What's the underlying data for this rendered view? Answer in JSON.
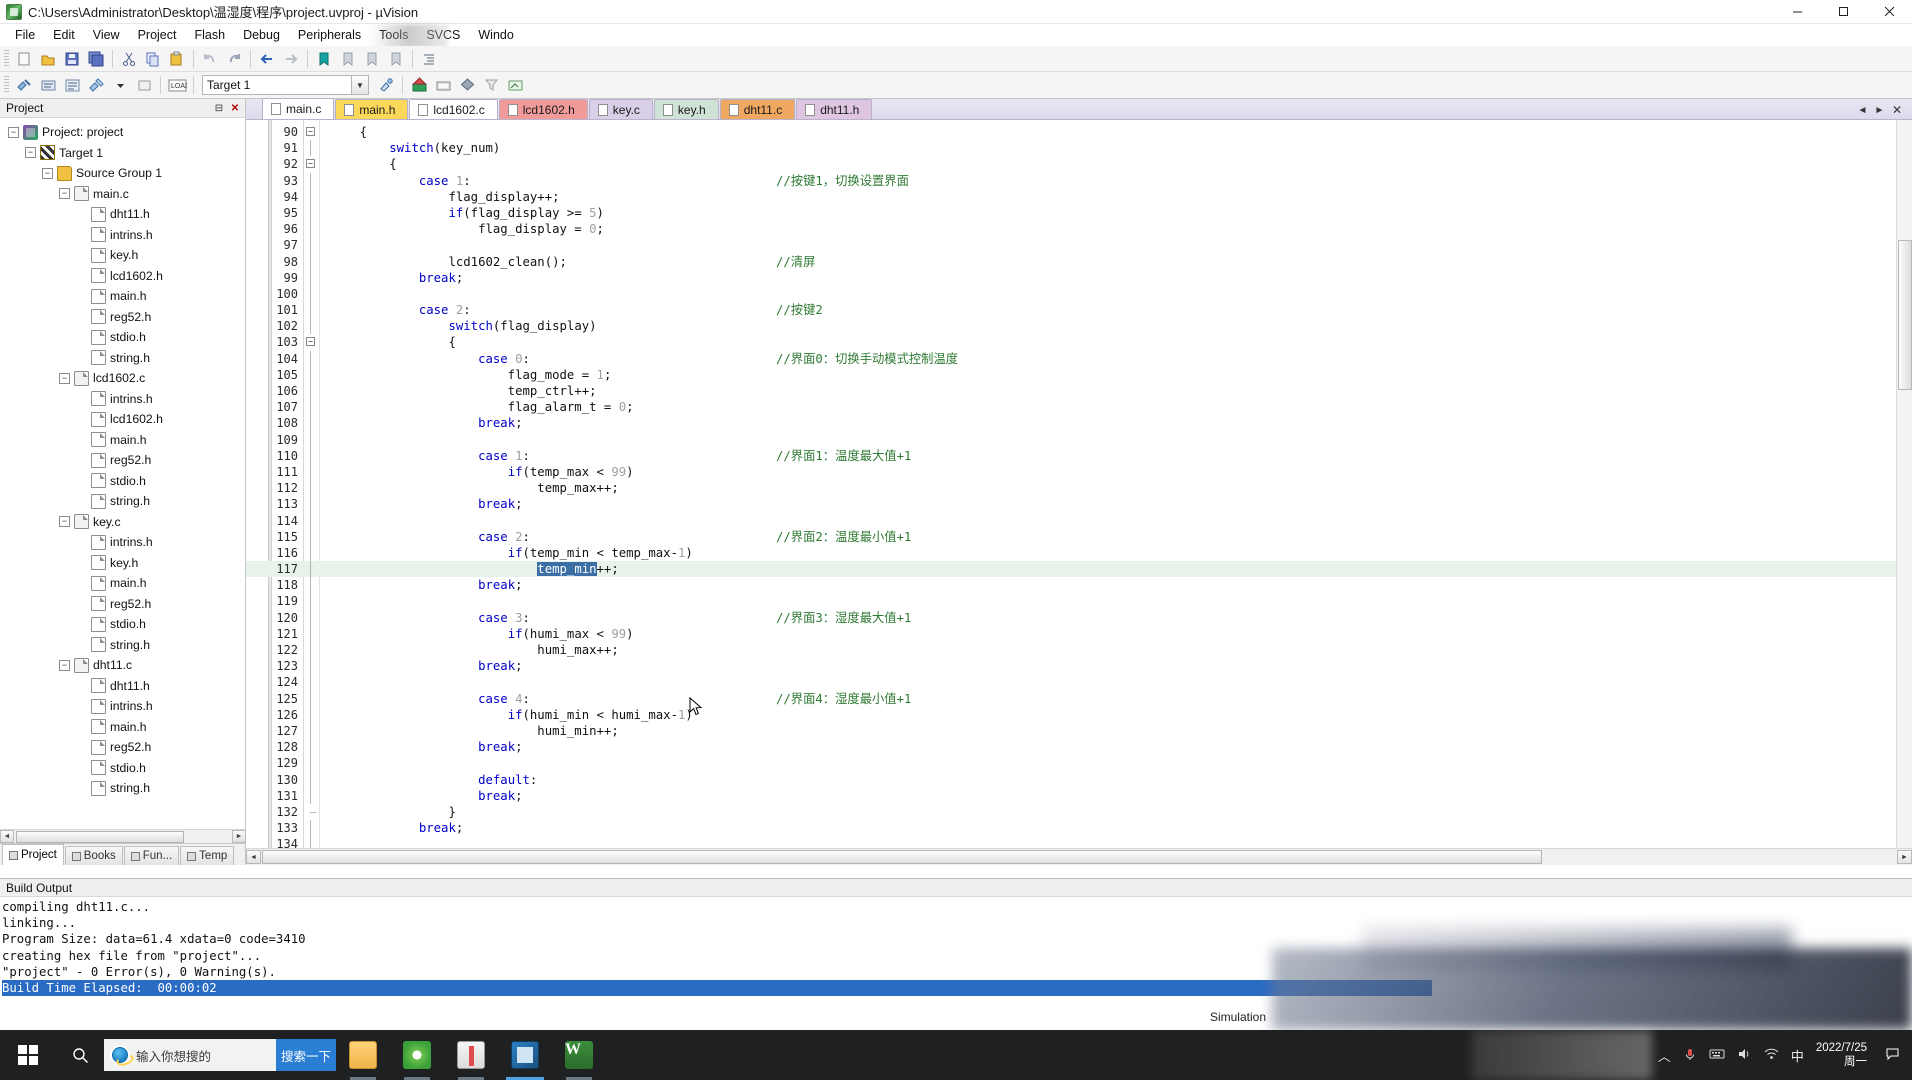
{
  "window": {
    "title": "C:\\Users\\Administrator\\Desktop\\温湿度\\程序\\project.uvproj - µVision",
    "minimize": "—",
    "maximize": "▢",
    "close": "✕"
  },
  "menu": {
    "items": [
      "File",
      "Edit",
      "View",
      "Project",
      "Flash",
      "Debug",
      "Peripherals",
      "Tools",
      "SVCS",
      "Windo"
    ]
  },
  "toolbar": {
    "target_value": "Target 1",
    "combo_arrow": "▼"
  },
  "project_panel": {
    "title": "Project",
    "pin": "⊟",
    "close": "✕",
    "tree": [
      {
        "label": "Project: project",
        "indent": 0,
        "expander": "−",
        "icon": "project-icon"
      },
      {
        "label": "Target 1",
        "indent": 1,
        "expander": "−",
        "icon": "target-icon"
      },
      {
        "label": "Source Group 1",
        "indent": 2,
        "expander": "−",
        "icon": "folder-icon"
      },
      {
        "label": "main.c",
        "indent": 3,
        "expander": "−",
        "icon": "c-file-icon"
      },
      {
        "label": "dht11.h",
        "indent": 4,
        "expander": "",
        "icon": "header-file-icon"
      },
      {
        "label": "intrins.h",
        "indent": 4,
        "expander": "",
        "icon": "header-file-icon"
      },
      {
        "label": "key.h",
        "indent": 4,
        "expander": "",
        "icon": "header-file-icon"
      },
      {
        "label": "lcd1602.h",
        "indent": 4,
        "expander": "",
        "icon": "header-file-icon"
      },
      {
        "label": "main.h",
        "indent": 4,
        "expander": "",
        "icon": "header-file-icon"
      },
      {
        "label": "reg52.h",
        "indent": 4,
        "expander": "",
        "icon": "header-file-icon"
      },
      {
        "label": "stdio.h",
        "indent": 4,
        "expander": "",
        "icon": "header-file-icon"
      },
      {
        "label": "string.h",
        "indent": 4,
        "expander": "",
        "icon": "header-file-icon"
      },
      {
        "label": "lcd1602.c",
        "indent": 3,
        "expander": "−",
        "icon": "c-file-icon"
      },
      {
        "label": "intrins.h",
        "indent": 4,
        "expander": "",
        "icon": "header-file-icon"
      },
      {
        "label": "lcd1602.h",
        "indent": 4,
        "expander": "",
        "icon": "header-file-icon"
      },
      {
        "label": "main.h",
        "indent": 4,
        "expander": "",
        "icon": "header-file-icon"
      },
      {
        "label": "reg52.h",
        "indent": 4,
        "expander": "",
        "icon": "header-file-icon"
      },
      {
        "label": "stdio.h",
        "indent": 4,
        "expander": "",
        "icon": "header-file-icon"
      },
      {
        "label": "string.h",
        "indent": 4,
        "expander": "",
        "icon": "header-file-icon"
      },
      {
        "label": "key.c",
        "indent": 3,
        "expander": "−",
        "icon": "c-file-icon"
      },
      {
        "label": "intrins.h",
        "indent": 4,
        "expander": "",
        "icon": "header-file-icon"
      },
      {
        "label": "key.h",
        "indent": 4,
        "expander": "",
        "icon": "header-file-icon"
      },
      {
        "label": "main.h",
        "indent": 4,
        "expander": "",
        "icon": "header-file-icon"
      },
      {
        "label": "reg52.h",
        "indent": 4,
        "expander": "",
        "icon": "header-file-icon"
      },
      {
        "label": "stdio.h",
        "indent": 4,
        "expander": "",
        "icon": "header-file-icon"
      },
      {
        "label": "string.h",
        "indent": 4,
        "expander": "",
        "icon": "header-file-icon"
      },
      {
        "label": "dht11.c",
        "indent": 3,
        "expander": "−",
        "icon": "c-file-icon"
      },
      {
        "label": "dht11.h",
        "indent": 4,
        "expander": "",
        "icon": "header-file-icon"
      },
      {
        "label": "intrins.h",
        "indent": 4,
        "expander": "",
        "icon": "header-file-icon"
      },
      {
        "label": "main.h",
        "indent": 4,
        "expander": "",
        "icon": "header-file-icon"
      },
      {
        "label": "reg52.h",
        "indent": 4,
        "expander": "",
        "icon": "header-file-icon"
      },
      {
        "label": "stdio.h",
        "indent": 4,
        "expander": "",
        "icon": "header-file-icon"
      },
      {
        "label": "string.h",
        "indent": 4,
        "expander": "",
        "icon": "header-file-icon"
      }
    ],
    "bottom_tabs": [
      {
        "label": "Project",
        "active": true
      },
      {
        "label": "Books",
        "active": false
      },
      {
        "label": "Fun...",
        "active": false
      },
      {
        "label": "Temp",
        "active": false
      }
    ]
  },
  "editor": {
    "tabs": [
      {
        "label": "main.c",
        "color": "#ffffff",
        "active": true
      },
      {
        "label": "main.h",
        "color": "#fbd85a",
        "active": false
      },
      {
        "label": "lcd1602.c",
        "color": "#ffffff",
        "active": false
      },
      {
        "label": "lcd1602.h",
        "color": "#f09a9a",
        "active": false
      },
      {
        "label": "key.c",
        "color": "#d9cfe8",
        "active": false
      },
      {
        "label": "key.h",
        "color": "#cfe2d6",
        "active": false
      },
      {
        "label": "dht11.c",
        "color": "#f0a860",
        "active": false
      },
      {
        "label": "dht11.h",
        "color": "#dfc6e0",
        "active": false
      }
    ],
    "nav_prev": "◄",
    "nav_next": "►",
    "close_tab": "✕",
    "selection_text": "temp_min",
    "lines": [
      {
        "n": 90,
        "fold": "−",
        "code": "    {"
      },
      {
        "n": 91,
        "fold": "|",
        "code": "        switch(key_num)"
      },
      {
        "n": 92,
        "fold": "−",
        "code": "        {"
      },
      {
        "n": 93,
        "fold": "|",
        "code": "            case 1:",
        "comment": "//按键1，切换设置界面"
      },
      {
        "n": 94,
        "fold": "|",
        "code": "                flag_display++;"
      },
      {
        "n": 95,
        "fold": "|",
        "code": "                if(flag_display >= 5)"
      },
      {
        "n": 96,
        "fold": "|",
        "code": "                    flag_display = 0;"
      },
      {
        "n": 97,
        "fold": "|",
        "code": ""
      },
      {
        "n": 98,
        "fold": "|",
        "code": "                lcd1602_clean();",
        "comment": "//清屏"
      },
      {
        "n": 99,
        "fold": "|",
        "code": "            break;"
      },
      {
        "n": 100,
        "fold": "|",
        "code": ""
      },
      {
        "n": 101,
        "fold": "|",
        "code": "            case 2:",
        "comment": "//按键2"
      },
      {
        "n": 102,
        "fold": "|",
        "code": "                switch(flag_display)"
      },
      {
        "n": 103,
        "fold": "−",
        "code": "                {"
      },
      {
        "n": 104,
        "fold": "|",
        "code": "                    case 0:",
        "comment": "//界面0：切换手动模式控制温度"
      },
      {
        "n": 105,
        "fold": "|",
        "code": "                        flag_mode = 1;"
      },
      {
        "n": 106,
        "fold": "|",
        "code": "                        temp_ctrl++;"
      },
      {
        "n": 107,
        "fold": "|",
        "code": "                        flag_alarm_t = 0;"
      },
      {
        "n": 108,
        "fold": "|",
        "code": "                    break;"
      },
      {
        "n": 109,
        "fold": "|",
        "code": ""
      },
      {
        "n": 110,
        "fold": "|",
        "code": "                    case 1:",
        "comment": "//界面1：温度最大值+1"
      },
      {
        "n": 111,
        "fold": "|",
        "code": "                        if(temp_max < 99)"
      },
      {
        "n": 112,
        "fold": "|",
        "code": "                            temp_max++;"
      },
      {
        "n": 113,
        "fold": "|",
        "code": "                    break;"
      },
      {
        "n": 114,
        "fold": "|",
        "code": ""
      },
      {
        "n": 115,
        "fold": "|",
        "code": "                    case 2:",
        "comment": "//界面2：温度最小值+1"
      },
      {
        "n": 116,
        "fold": "|",
        "code": "                        if(temp_min < temp_max-1)"
      },
      {
        "n": 117,
        "fold": "|",
        "code": "                            temp_min++;",
        "highlight": true,
        "selected": true
      },
      {
        "n": 118,
        "fold": "|",
        "code": "                    break;"
      },
      {
        "n": 119,
        "fold": "|",
        "code": ""
      },
      {
        "n": 120,
        "fold": "|",
        "code": "                    case 3:",
        "comment": "//界面3：湿度最大值+1"
      },
      {
        "n": 121,
        "fold": "|",
        "code": "                        if(humi_max < 99)"
      },
      {
        "n": 122,
        "fold": "|",
        "code": "                            humi_max++;"
      },
      {
        "n": 123,
        "fold": "|",
        "code": "                    break;"
      },
      {
        "n": 124,
        "fold": "|",
        "code": ""
      },
      {
        "n": 125,
        "fold": "|",
        "code": "                    case 4:",
        "comment": "//界面4：湿度最小值+1"
      },
      {
        "n": 126,
        "fold": "|",
        "code": "                        if(humi_min < humi_max-1)"
      },
      {
        "n": 127,
        "fold": "|",
        "code": "                            humi_min++;"
      },
      {
        "n": 128,
        "fold": "|",
        "code": "                    break;"
      },
      {
        "n": 129,
        "fold": "|",
        "code": ""
      },
      {
        "n": 130,
        "fold": "|",
        "code": "                    default:"
      },
      {
        "n": 131,
        "fold": "|",
        "code": "                    break;"
      },
      {
        "n": 132,
        "fold": "e",
        "code": "                }"
      },
      {
        "n": 133,
        "fold": "|",
        "code": "            break;"
      },
      {
        "n": 134,
        "fold": "|",
        "code": ""
      }
    ]
  },
  "build_output": {
    "title": "Build Output",
    "lines": [
      {
        "text": "compiling dht11.c...",
        "selected": false
      },
      {
        "text": "linking...",
        "selected": false
      },
      {
        "text": "Program Size: data=61.4 xdata=0 code=3410",
        "selected": false
      },
      {
        "text": "creating hex file from \"project\"...",
        "selected": false
      },
      {
        "text": "\"project\" - 0 Error(s), 0 Warning(s).",
        "selected": false
      },
      {
        "text": "Build Time Elapsed:  00:00:02",
        "selected": true
      }
    ],
    "simulation_label": "Simulation"
  },
  "taskbar": {
    "search_placeholder": "输入你想搜的",
    "search_button": "搜索一下",
    "apps": [
      {
        "name": "file-explorer",
        "glyph_class": "g-explorer"
      },
      {
        "name": "browser",
        "glyph_class": "g-chrome"
      },
      {
        "name": "reader",
        "glyph_class": "g-book"
      },
      {
        "name": "keil-uvision",
        "glyph_class": "g-keil"
      },
      {
        "name": "wps-office",
        "glyph_class": "g-word",
        "text": "W"
      }
    ],
    "tray": {
      "chevron": "︿",
      "mic": "🎤",
      "network": "⌨",
      "volume": "🔊",
      "ime": "中",
      "time": "2022/7/25",
      "date": "周一"
    }
  }
}
